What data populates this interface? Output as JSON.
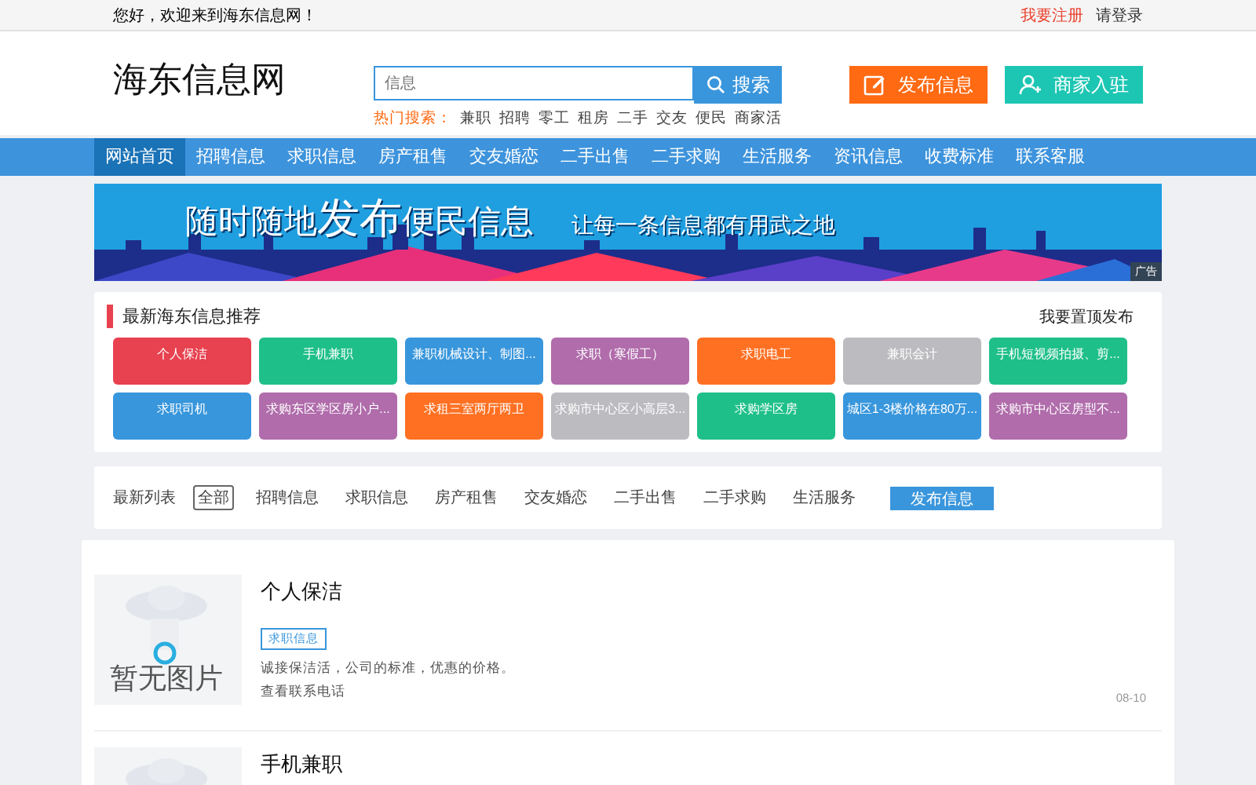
{
  "top_bar": {
    "welcome": "您好，欢迎来到海东信息网！",
    "links": [
      {
        "label": "我要注册",
        "kind": "highlight"
      },
      {
        "label": "请登录",
        "kind": "plain"
      }
    ]
  },
  "header": {
    "logo": "海东信息网",
    "search": {
      "placeholder": "信息",
      "button": "搜索"
    },
    "hot_label": "热门搜索：",
    "hot": [
      "兼职",
      "招聘",
      "零工",
      "租房",
      "二手",
      "交友",
      "便民",
      "商家活"
    ],
    "actions": [
      {
        "label": "发布信息",
        "kind": "post",
        "color": "#ff6a13"
      },
      {
        "label": "商家入驻",
        "kind": "merchant",
        "color": "#1dc6b3"
      }
    ]
  },
  "nav": [
    {
      "label": "网站首页",
      "selected": true
    },
    {
      "label": "招聘信息",
      "selected": false
    },
    {
      "label": "求职信息",
      "selected": false
    },
    {
      "label": "房产租售",
      "selected": false
    },
    {
      "label": "交友婚恋",
      "selected": false
    },
    {
      "label": "二手出售",
      "selected": false
    },
    {
      "label": "二手求购",
      "selected": false
    },
    {
      "label": "生活服务",
      "selected": false
    },
    {
      "label": "资讯信息",
      "selected": false
    },
    {
      "label": "收费标准",
      "selected": false
    },
    {
      "label": "联系客服",
      "selected": false
    }
  ],
  "banner": {
    "headline_a": "随时随地",
    "headline_b": "发布",
    "headline_c": "便民信息",
    "slogan": "让每一条信息都有用武之地",
    "ad_tag": "广告"
  },
  "recommend": {
    "title": "最新海东信息推荐",
    "link": "我要置顶发布",
    "tiles": [
      {
        "label": "个人保洁",
        "color": "#e8414f"
      },
      {
        "label": "手机兼职",
        "color": "#1fbf8a"
      },
      {
        "label": "兼职机械设计、制图...",
        "color": "#3896dc"
      },
      {
        "label": "求职（寒假工）",
        "color": "#b06cab"
      },
      {
        "label": "求职电工",
        "color": "#ff7022"
      },
      {
        "label": "兼职会计",
        "color": "#bcbbbf"
      },
      {
        "label": "手机短视频拍摄、剪...",
        "color": "#1fbf8a"
      },
      {
        "label": "求职司机",
        "color": "#3896dc"
      },
      {
        "label": "求购东区学区房小户...",
        "color": "#b06cab"
      },
      {
        "label": "求租三室两厅两卫",
        "color": "#ff7022"
      },
      {
        "label": "求购市中心区小高层3...",
        "color": "#bcbbbf"
      },
      {
        "label": "求购学区房",
        "color": "#1fbf8a"
      },
      {
        "label": "城区1-3楼价格在80万...",
        "color": "#3896dc"
      },
      {
        "label": "求购市中心区房型不...",
        "color": "#b06cab"
      }
    ]
  },
  "filter": {
    "label": "最新列表",
    "options": [
      {
        "label": "全部",
        "selected": true
      },
      {
        "label": "招聘信息",
        "selected": false
      },
      {
        "label": "求职信息",
        "selected": false
      },
      {
        "label": "房产租售",
        "selected": false
      },
      {
        "label": "交友婚恋",
        "selected": false
      },
      {
        "label": "二手出售",
        "selected": false
      },
      {
        "label": "二手求购",
        "selected": false
      },
      {
        "label": "生活服务",
        "selected": false
      }
    ],
    "button": "发布信息"
  },
  "listings": [
    {
      "title": "个人保洁",
      "no_image_text": "暂无图片",
      "tag": "求职信息",
      "description": "诚接保洁活，公司的标准，优惠的价格。",
      "contact": "查看联系电话",
      "date": "08-10"
    },
    {
      "title": "手机兼职"
    }
  ]
}
